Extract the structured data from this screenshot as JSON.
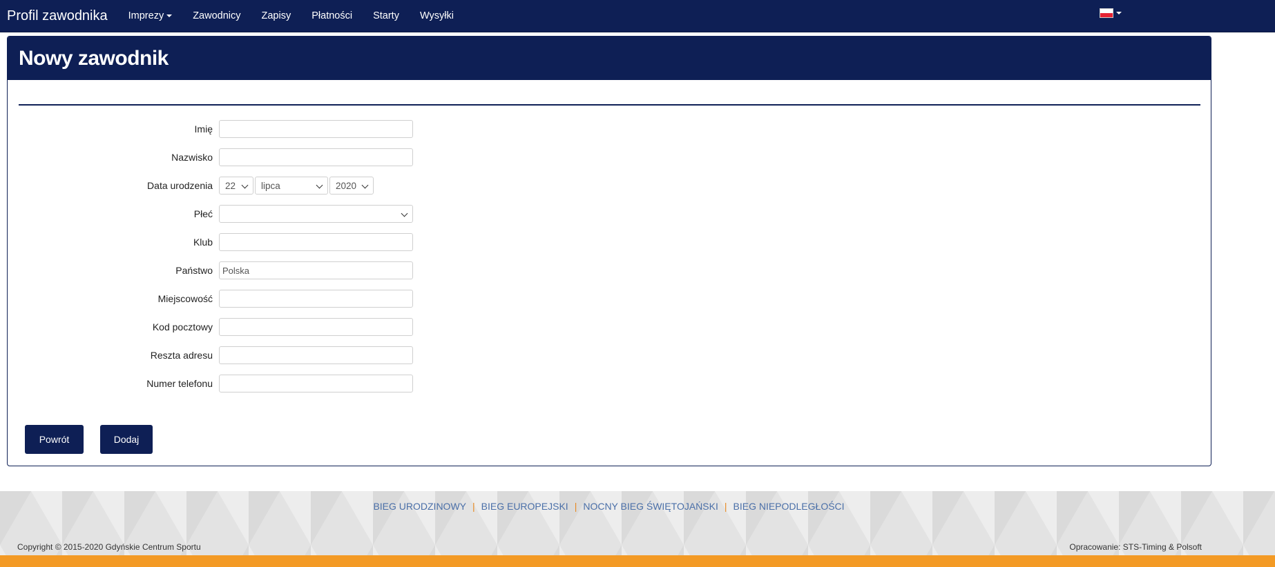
{
  "navbar": {
    "brand": "Profil zawodnika",
    "items": [
      {
        "label": "Imprezy",
        "dropdown": true
      },
      {
        "label": "Zawodnicy"
      },
      {
        "label": "Zapisy"
      },
      {
        "label": "Płatności"
      },
      {
        "label": "Starty"
      },
      {
        "label": "Wysyłki"
      }
    ],
    "language_icon": "poland-flag-icon"
  },
  "panel": {
    "title": "Nowy zawodnik"
  },
  "form": {
    "first_name": {
      "label": "Imię",
      "value": ""
    },
    "last_name": {
      "label": "Nazwisko",
      "value": ""
    },
    "birth_date": {
      "label": "Data urodzenia",
      "day": "22",
      "month": "lipca",
      "year": "2020"
    },
    "gender": {
      "label": "Płeć",
      "value": ""
    },
    "club": {
      "label": "Klub",
      "value": ""
    },
    "country": {
      "label": "Państwo",
      "value": "Polska"
    },
    "city": {
      "label": "Miejscowość",
      "value": ""
    },
    "postal_code": {
      "label": "Kod pocztowy",
      "value": ""
    },
    "address_rest": {
      "label": "Reszta adresu",
      "value": ""
    },
    "phone": {
      "label": "Numer telefonu",
      "value": ""
    }
  },
  "buttons": {
    "back": "Powrót",
    "add": "Dodaj"
  },
  "footer": {
    "links": [
      "BIEG URODZINOWY",
      "BIEG EUROPEJSKI",
      "NOCNY BIEG ŚWIĘTOJAŃSKI",
      "BIEG NIEPODLEGŁOŚCI"
    ],
    "separator": "|",
    "copyright": "Copyright © 2015-2020 Gdyńskie Centrum Sportu",
    "credits": "Opracowanie: STS-Timing & Polsoft"
  },
  "colors": {
    "primary": "#0e1f55",
    "accent": "#f39a25",
    "link": "#4a6fa8"
  }
}
